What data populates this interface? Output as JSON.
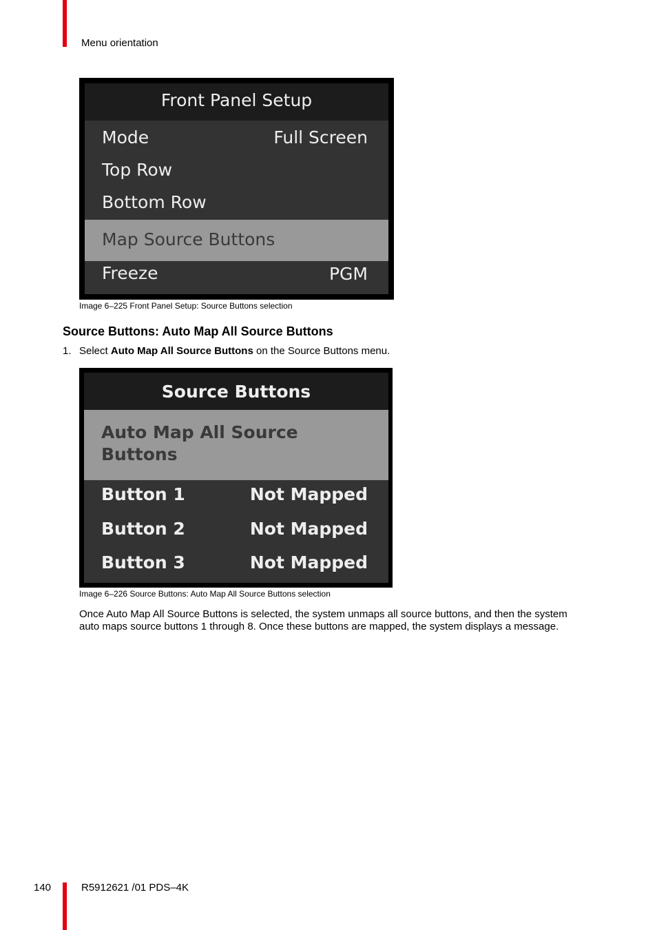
{
  "header": {
    "section": "Menu orientation"
  },
  "figure1": {
    "title": "Front Panel Setup",
    "rows": [
      {
        "label": "Mode",
        "value": "Full Screen",
        "selected": false
      },
      {
        "label": "Top Row",
        "value": "",
        "selected": false
      },
      {
        "label": "Bottom Row",
        "value": "",
        "selected": false
      },
      {
        "label": "Map Source Buttons",
        "value": "",
        "selected": true
      },
      {
        "label": "Freeze",
        "value": "PGM",
        "selected": false
      }
    ],
    "caption": "Image 6–225  Front Panel Setup: Source Buttons selection"
  },
  "section_heading": "Source Buttons: Auto Map All Source Buttons",
  "step1": {
    "number": "1.",
    "pre": "Select ",
    "bold": "Auto Map All Source Buttons",
    "post": " on the Source Buttons menu."
  },
  "figure2": {
    "title": "Source Buttons",
    "selected_item": {
      "line1": "Auto Map All Source",
      "line2": "Buttons"
    },
    "rows": [
      {
        "label": "Button 1",
        "value": "Not Mapped"
      },
      {
        "label": "Button 2",
        "value": "Not Mapped"
      },
      {
        "label": "Button 3",
        "value": "Not Mapped"
      }
    ],
    "caption": "Image 6–226  Source Buttons: Auto Map All Source Buttons selection"
  },
  "paragraph": "Once Auto Map All Source Buttons is selected, the system unmaps all source buttons, and then the system auto maps source buttons 1 through 8. Once these buttons are mapped, the system displays a message.",
  "footer": {
    "page_number": "140",
    "doc_id": "R5912621 /01  PDS–4K"
  },
  "colors": {
    "accent_red": "#e3000f",
    "osd_bg": "#333333",
    "osd_title_bg": "#1c1c1c",
    "osd_selected_bg": "#999999"
  }
}
